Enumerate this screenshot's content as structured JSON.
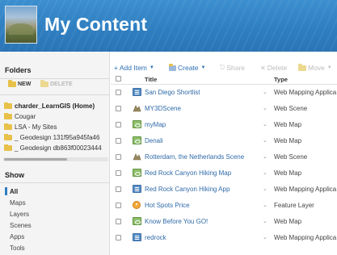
{
  "header": {
    "title": "My Content"
  },
  "sidebar": {
    "folders_heading": "Folders",
    "new_label": "NEW",
    "delete_label": "DELETE",
    "folders": [
      {
        "label": "charder_LearnGIS (Home)",
        "bold": true
      },
      {
        "label": "Cougar"
      },
      {
        "label": "LSA - My Sites"
      },
      {
        "label": "_ Geodesign 131f95a945fa46"
      },
      {
        "label": "_ Geodesign db863f00023444"
      }
    ],
    "show_heading": "Show",
    "show_items": [
      "All",
      "Maps",
      "Layers",
      "Scenes",
      "Apps",
      "Tools"
    ]
  },
  "toolbar": {
    "add_item": "+ Add Item",
    "create": "Create",
    "share": "Share",
    "delete": "Delete",
    "move": "Move"
  },
  "table": {
    "columns": {
      "title": "Title",
      "type": "Type"
    },
    "rows": [
      {
        "title": "San Diego Shortlist",
        "type": "Web Mapping Applica",
        "icon": "web-app-icon"
      },
      {
        "title": "MY3DScene",
        "type": "Web Scene",
        "icon": "web-scene-icon"
      },
      {
        "title": "myMap",
        "type": "Web Map",
        "icon": "web-map-icon"
      },
      {
        "title": "Denali",
        "type": "Web Map",
        "icon": "web-map-icon"
      },
      {
        "title": "Rotterdam, the Netherlands Scene",
        "type": "Web Scene",
        "icon": "web-scene-icon"
      },
      {
        "title": "Red Rock Canyon Hiking Map",
        "type": "Web Map",
        "icon": "web-map-icon"
      },
      {
        "title": "Red Rock Canyon Hiking App",
        "type": "Web Mapping Applica",
        "icon": "web-app-icon"
      },
      {
        "title": "Hot Spots Price",
        "type": "Feature Layer",
        "icon": "feature-layer-icon"
      },
      {
        "title": "Know Before You GO!",
        "type": "Web Map",
        "icon": "web-map-icon"
      },
      {
        "title": "redrock",
        "type": "Web Mapping Applica",
        "icon": "web-app-icon"
      }
    ]
  },
  "colors": {
    "banner": "#2f7fc1",
    "link": "#2f6aa8",
    "toolbar_active": "#2e6fb3",
    "toolbar_disabled": "#bdbdbd"
  }
}
